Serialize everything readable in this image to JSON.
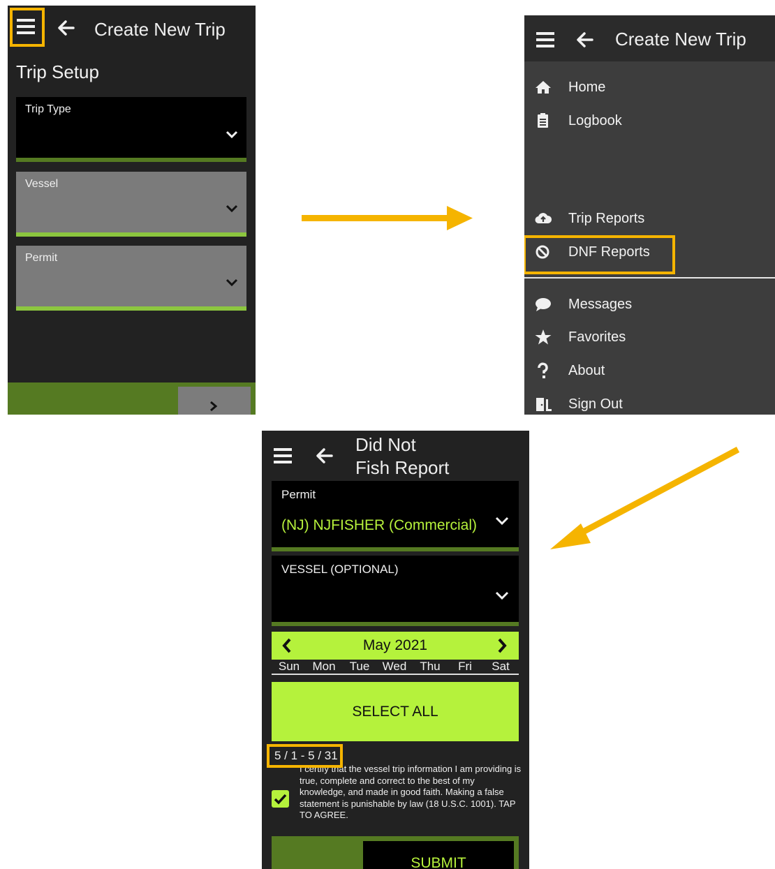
{
  "colors": {
    "highlight": "#f5b400",
    "accent": "#b5f23c",
    "footer": "#557a22",
    "dark": "#222222"
  },
  "screen1": {
    "title": "Create New Trip",
    "section_title": "Trip Setup",
    "fields": [
      {
        "label": "Trip Type"
      },
      {
        "label": "Vessel"
      },
      {
        "label": "Permit"
      }
    ],
    "icons": {
      "menu": "hamburger-menu-icon",
      "back": "back-arrow-icon",
      "next": "chevron-right-icon"
    }
  },
  "screen2": {
    "title": "Create New Trip",
    "menu_items": [
      {
        "label": "Home",
        "icon": "home-icon"
      },
      {
        "label": "Logbook",
        "icon": "clipboard-icon"
      },
      {
        "label": "Trip Reports",
        "icon": "cloud-upload-icon"
      },
      {
        "label": "DNF Reports",
        "icon": "ban-icon"
      },
      {
        "label": "Messages",
        "icon": "chat-bubble-icon"
      },
      {
        "label": "Favorites",
        "icon": "star-icon"
      },
      {
        "label": "About",
        "icon": "question-icon"
      },
      {
        "label": "Sign Out",
        "icon": "door-exit-icon"
      }
    ]
  },
  "screen3": {
    "title_line1": "Did Not",
    "title_line2": "Fish Report",
    "permit": {
      "label": "Permit",
      "value": "(NJ) NJFISHER (Commercial)"
    },
    "vessel": {
      "label": "VESSEL (OPTIONAL)",
      "value": ""
    },
    "calendar": {
      "month": "May 2021",
      "weekdays": [
        "Sun",
        "Mon",
        "Tue",
        "Wed",
        "Thu",
        "Fri",
        "Sat"
      ]
    },
    "select_all_label": "SELECT ALL",
    "date_range": "5 / 1 - 5 / 31",
    "certification_text": "I certify that the vessel trip information I am providing is true, complete and correct to the best of my knowledge, and made in good faith. Making a false statement is punishable by law (18 U.S.C. 1001). TAP TO AGREE.",
    "agree_checked": true,
    "submit_label": "SUBMIT"
  }
}
